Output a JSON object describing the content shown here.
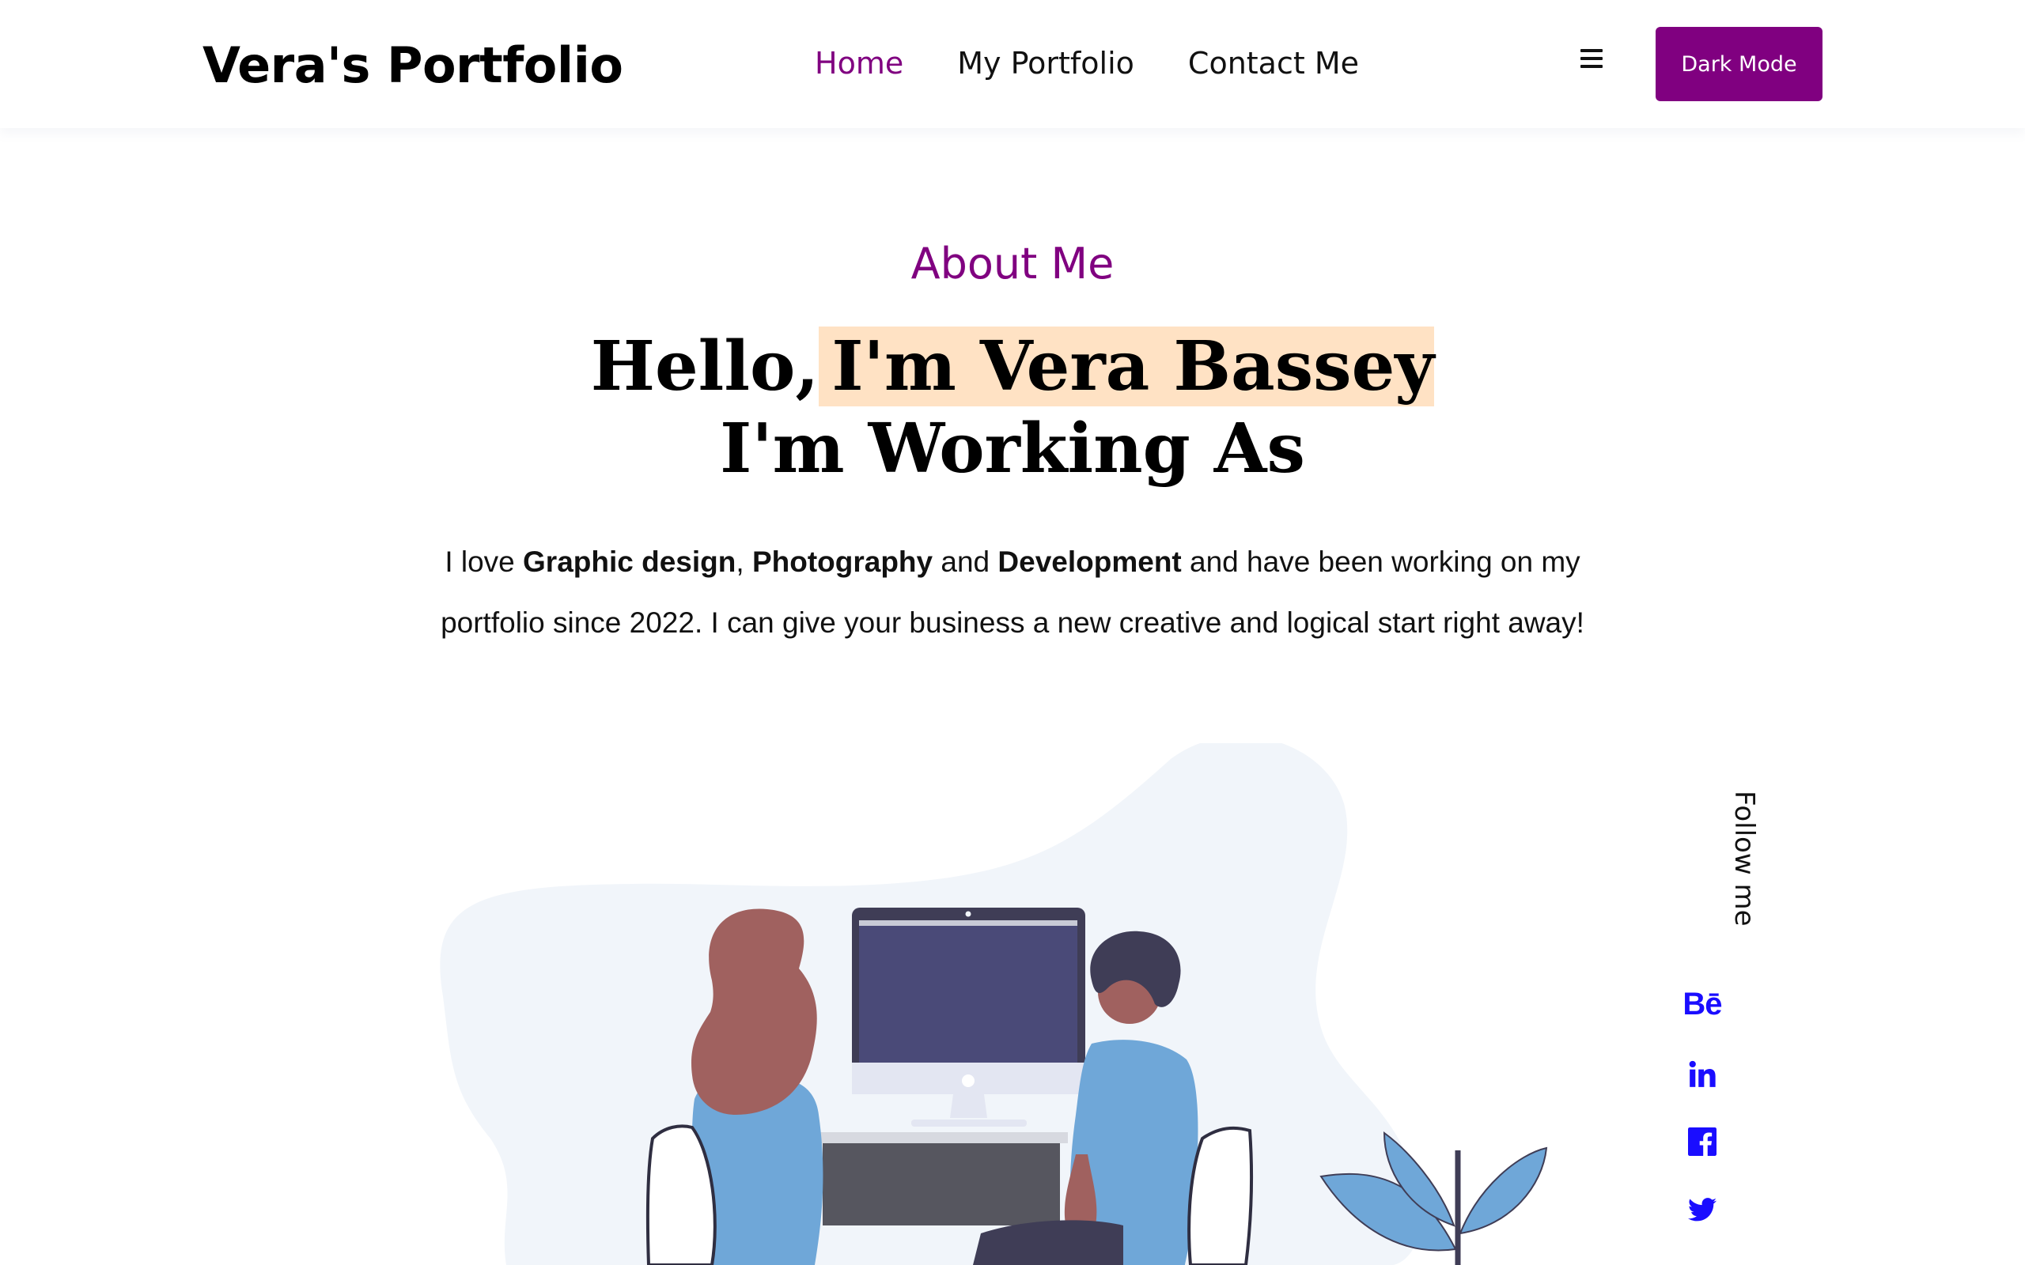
{
  "header": {
    "brand": "Vera's Portfolio",
    "nav": [
      {
        "label": "Home",
        "active": true
      },
      {
        "label": "My Portfolio",
        "active": false
      },
      {
        "label": "Contact Me",
        "active": false
      }
    ],
    "menu_icon": "hamburger-menu-icon",
    "dark_mode_label": "Dark Mode"
  },
  "hero": {
    "eyebrow": "About Me",
    "headline_prefix": "Hello,",
    "headline_name": "I'm Vera Bassey",
    "headline_line2": "I'm Working As",
    "intro": {
      "t1": "I love ",
      "b1": "Graphic design",
      "t2": ", ",
      "b2": "Photography",
      "t3": " and ",
      "b3": "Development",
      "t4": " and have been working on my portfolio since 2022. I can give your business a new creative and logical start right away!"
    }
  },
  "follow": {
    "label": "Follow me",
    "socials": [
      {
        "name": "behance",
        "icon": "behance-icon",
        "text": "Bē"
      },
      {
        "name": "linkedin",
        "icon": "linkedin-icon"
      },
      {
        "name": "facebook",
        "icon": "facebook-icon"
      },
      {
        "name": "twitter",
        "icon": "twitter-icon"
      }
    ]
  },
  "colors": {
    "accent": "#800080",
    "highlight": "#ffe2c4",
    "social": "#1a0dff"
  }
}
